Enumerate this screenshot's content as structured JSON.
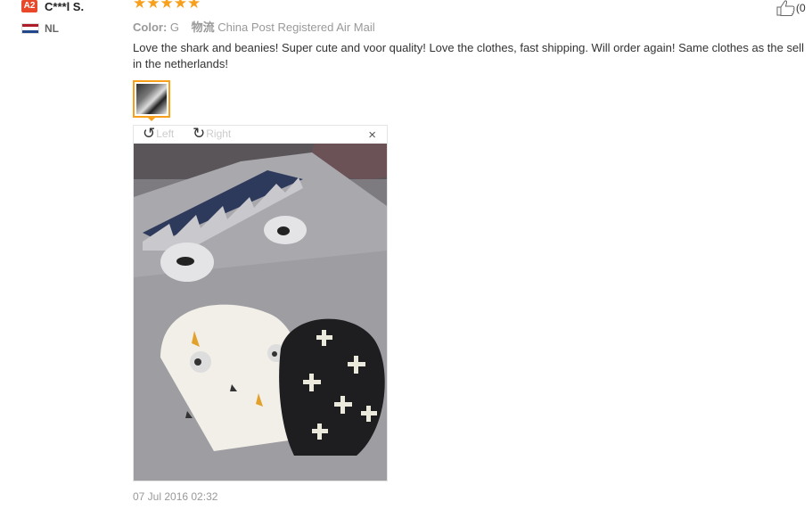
{
  "user": {
    "level": "A2",
    "name": "C***l S.",
    "country": "NL"
  },
  "review": {
    "rating": 5,
    "color_label": "Color:",
    "color_value": "G",
    "shipping_label": "物流",
    "shipping_value": "China Post Registered Air Mail",
    "text": "Love the shark and beanies! Super cute and voor quality! Love the clothes, fast shipping. Will order again! Same clothes as the sell in the netherlands!",
    "date": "07 Jul 2016 02:32"
  },
  "viewer": {
    "rotate_left_label": "Left",
    "rotate_right_label": "Right",
    "close_label": "×"
  },
  "helpful": {
    "count_label": "(0"
  },
  "colors": {
    "star": "#f89f1c",
    "badge": "#e8472a",
    "accent_border": "#f89f1c"
  },
  "icons": [
    "star-icon",
    "rotate-left-icon",
    "rotate-right-icon",
    "close-icon",
    "thumbs-up-icon",
    "flag-nl-icon"
  ]
}
